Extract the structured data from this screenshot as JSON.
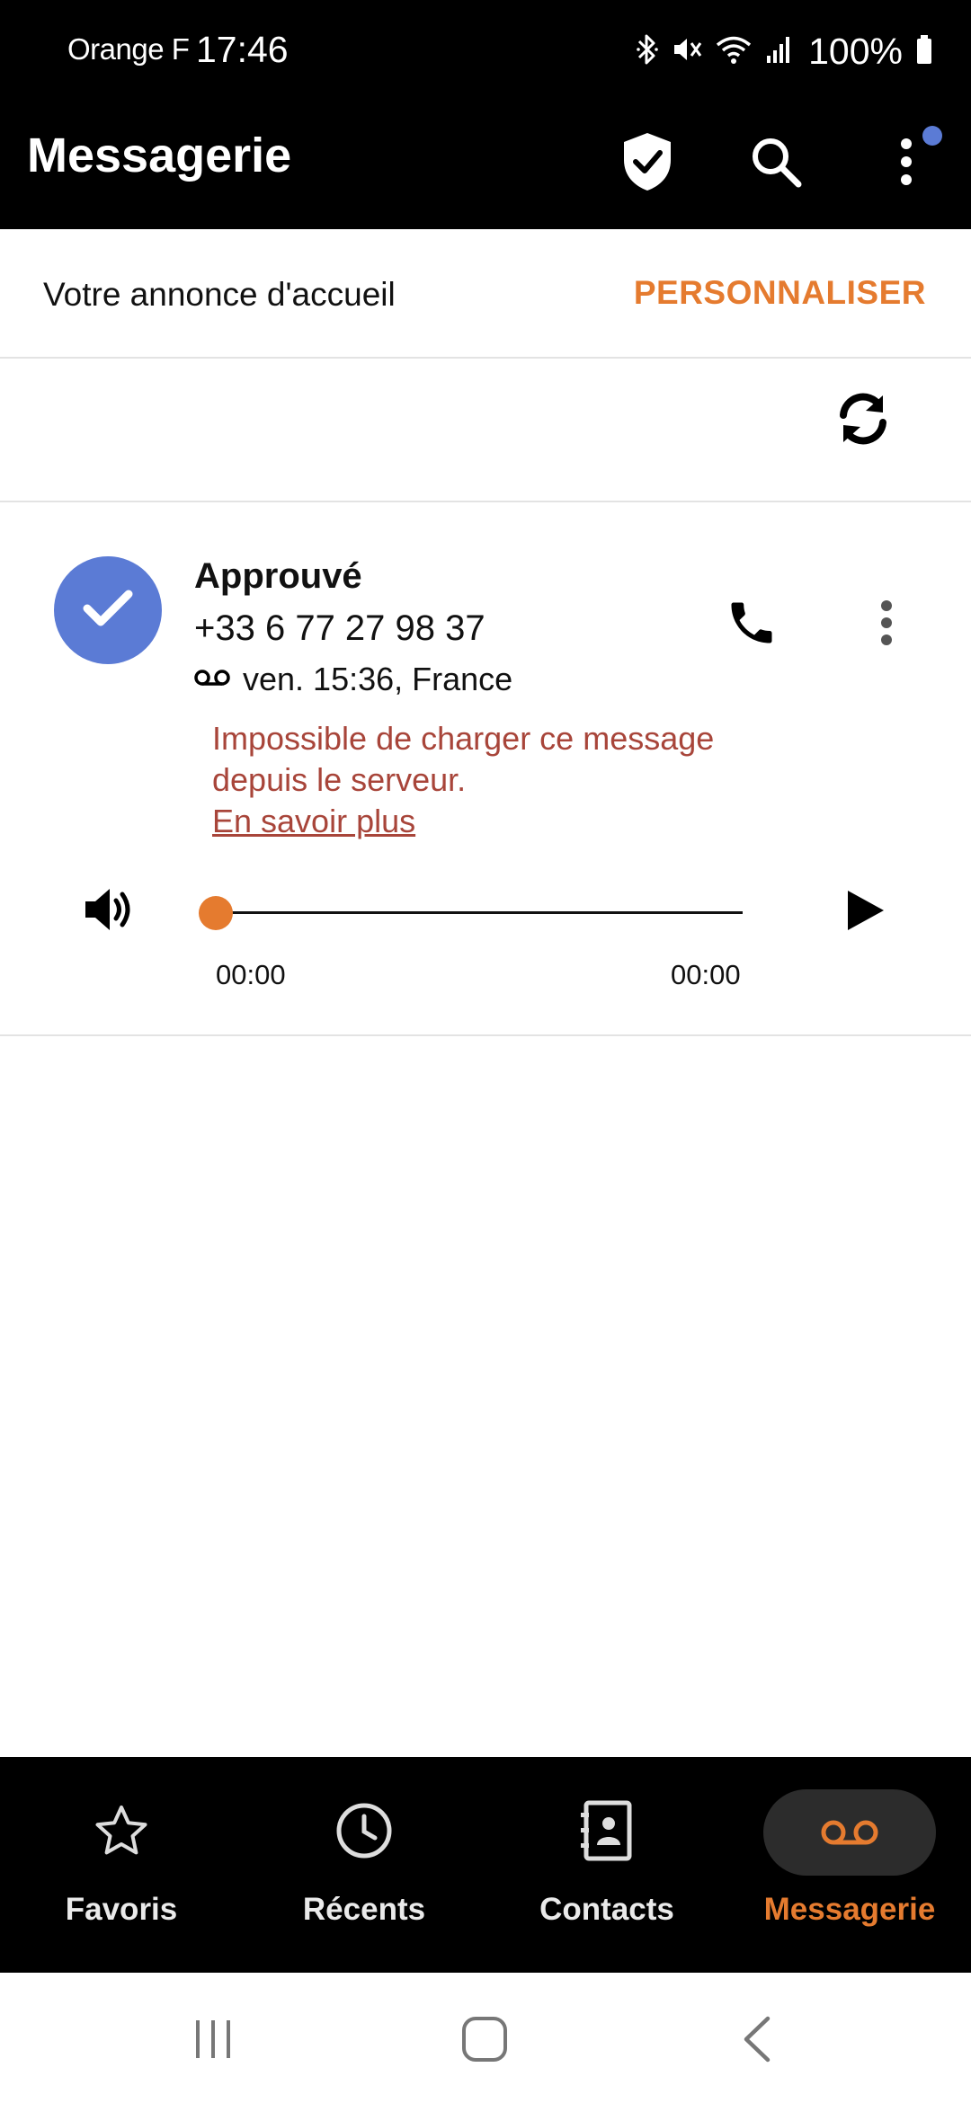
{
  "status_bar": {
    "carrier": "Orange F",
    "time": "17:46",
    "battery": "100%",
    "icons": [
      "bluetooth-icon",
      "mute-icon",
      "wifi-icon",
      "signal-icon",
      "battery-icon"
    ]
  },
  "app_bar": {
    "title": "Messagerie",
    "icons": [
      "shield-check-icon",
      "search-icon",
      "more-vert-icon"
    ]
  },
  "greeting": {
    "label": "Votre annonce d'accueil",
    "action": "PERSONNALISER"
  },
  "message": {
    "status": "Approuvé",
    "number": "+33 6 77 27 98 37",
    "meta": "ven. 15:36, France",
    "error_line1": "Impossible de charger ce message",
    "error_line2": "depuis le serveur.",
    "learn_more": "En savoir plus",
    "time_start": "00:00",
    "time_end": "00:00",
    "progress": 0
  },
  "bottom_nav": {
    "items": [
      {
        "label": "Favoris",
        "icon": "star-icon"
      },
      {
        "label": "Récents",
        "icon": "clock-icon"
      },
      {
        "label": "Contacts",
        "icon": "contacts-icon"
      },
      {
        "label": "Messagerie",
        "icon": "voicemail-icon"
      }
    ],
    "active": "Messagerie"
  },
  "colors": {
    "accent": "#e57b2f",
    "avatar": "#5b7bd5",
    "error": "#a8453a",
    "bar": "#000000"
  }
}
